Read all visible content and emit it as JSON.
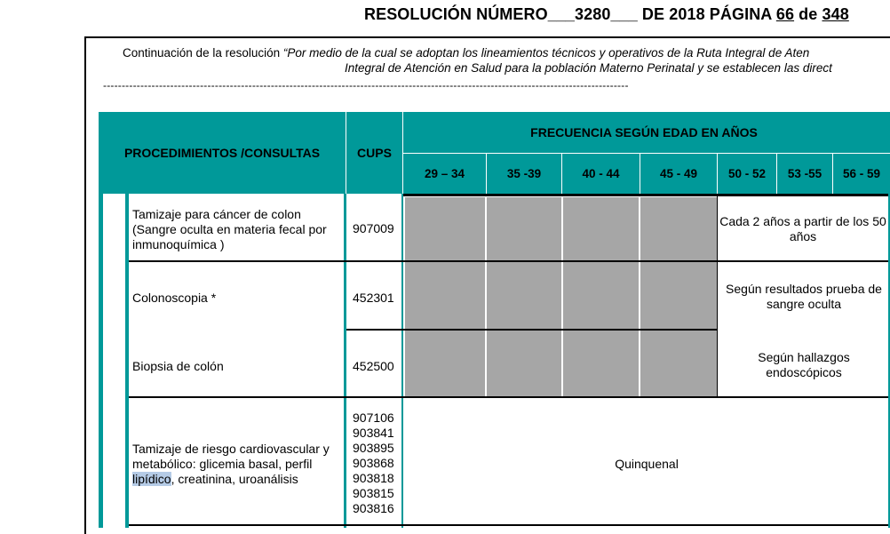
{
  "header": {
    "prefix": "RESOLUCIÓN NÚMERO___",
    "number": "3280",
    "mid": "___ DE 2018 PÁGINA ",
    "page": "66",
    "of": " de ",
    "total": "348"
  },
  "continuation": {
    "line1_prefix": "Continuación de la resolución ",
    "line1_italic": "“Por medio de la cual se adoptan los lineamientos técnicos y operativos  de la Ruta Integral de Aten",
    "line2": "Integral de Atención en Salud para la población Materno Perinatal y se establecen las direct",
    "dashes": "---------------------------------------------------------------------------------------------------------------------------------------------"
  },
  "table": {
    "col_procedures": "PROCEDIMIENTOS /CONSULTAS",
    "col_cups": "CUPS",
    "col_frequency": "FRECUENCIA SEGÚN EDAD EN AÑOS",
    "age_groups": [
      "29 – 34",
      "35 -39",
      "40 - 44",
      "45 - 49",
      "50 - 52",
      "53 -55",
      "56 - 59"
    ],
    "rows": [
      {
        "procedure": "Tamizaje para cáncer de colon (Sangre oculta en materia fecal por inmunoquímica )",
        "cups": "907009",
        "frequency": "Cada 2 años a partir de los 50 años"
      },
      {
        "procedure": "Colonoscopia *",
        "cups": "452301",
        "frequency": "Según resultados prueba de sangre oculta"
      },
      {
        "procedure": "Biopsia de colón",
        "cups": "452500",
        "frequency": "Según hallazgos endoscópicos"
      },
      {
        "procedure_before": "Tamizaje de riesgo cardiovascular y metabólico: glicemia basal, perfil ",
        "procedure_highlight": "lipídico",
        "procedure_after": ", creatinina, uroanálisis",
        "cups_list": [
          "907106",
          "903841",
          "903895",
          "903868",
          "903818",
          "903815",
          "903816"
        ],
        "frequency": "Quinquenal"
      }
    ]
  },
  "colors": {
    "header_teal": "#009999",
    "not_applicable_gray": "#a6a6a6",
    "selection_highlight": "#b5cbe6"
  }
}
